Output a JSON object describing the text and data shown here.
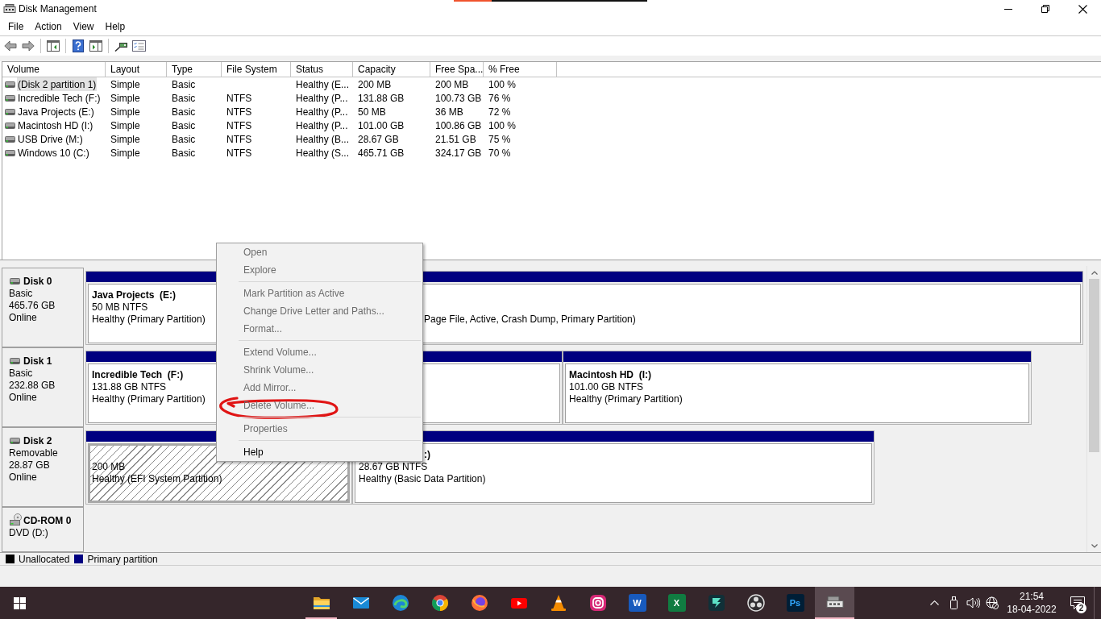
{
  "window": {
    "title": "Disk Management"
  },
  "menu": [
    "File",
    "Action",
    "View",
    "Help"
  ],
  "volume_list": {
    "columns": [
      "Volume",
      "Layout",
      "Type",
      "File System",
      "Status",
      "Capacity",
      "Free Spa...",
      "% Free"
    ],
    "rows": [
      {
        "volume": "(Disk 2 partition 1)",
        "layout": "Simple",
        "type": "Basic",
        "status": "Healthy (E...",
        "capacity": "200 MB",
        "free_space": "200 MB",
        "percent_free": "100 %",
        "selected": true
      },
      {
        "volume": "Incredible Tech (F:)",
        "layout": "Simple",
        "type": "Basic",
        "file_system": "NTFS",
        "status": "Healthy (P...",
        "capacity": "131.88 GB",
        "free_space": "100.73 GB",
        "percent_free": "76 %",
        "selected": false
      },
      {
        "volume": "Java Projects (E:)",
        "layout": "Simple",
        "type": "Basic",
        "file_system": "NTFS",
        "status": "Healthy (P...",
        "capacity": "50 MB",
        "free_space": "36 MB",
        "percent_free": "72 %",
        "selected": false
      },
      {
        "volume": "Macintosh HD (I:)",
        "layout": "Simple",
        "type": "Basic",
        "file_system": "NTFS",
        "status": "Healthy (P...",
        "capacity": "101.00 GB",
        "free_space": "100.86 GB",
        "percent_free": "100 %",
        "selected": false
      },
      {
        "volume": "USB Drive (M:)",
        "layout": "Simple",
        "type": "Basic",
        "file_system": "NTFS",
        "status": "Healthy (B...",
        "capacity": "28.67 GB",
        "free_space": "21.51 GB",
        "percent_free": "75 %",
        "selected": false
      },
      {
        "volume": "Windows 10 (C:)",
        "layout": "Simple",
        "type": "Basic",
        "file_system": "NTFS",
        "status": "Healthy (S...",
        "capacity": "465.71 GB",
        "free_space": "324.17 GB",
        "percent_free": "70 %",
        "selected": false
      }
    ]
  },
  "disks": [
    {
      "kind": "disk",
      "name": "Disk 0",
      "details": [
        "Basic",
        "465.76 GB",
        "Online"
      ],
      "partitions": [
        {
          "title": "Java Projects  (E:)",
          "size": "50 MB NTFS",
          "status": "Healthy (Primary Partition)",
          "selected": false
        },
        {
          "status": "Page File, Active, Crash Dump, Primary Partition)",
          "selected": false
        }
      ]
    },
    {
      "kind": "disk",
      "name": "Disk 1",
      "details": [
        "Basic",
        "232.88 GB",
        "Online"
      ],
      "partitions": [
        {
          "title": "Incredible Tech  (F:)",
          "size": "131.88 GB NTFS",
          "status": "Healthy (Primary Partition)",
          "selected": false
        },
        {
          "title": "Macintosh HD  (I:)",
          "size": "101.00 GB NTFS",
          "status": "Healthy (Primary Partition)",
          "selected": false
        }
      ]
    },
    {
      "kind": "disk",
      "name": "Disk 2",
      "details": [
        "Removable",
        "28.87 GB",
        "Online"
      ],
      "partitions": [
        {
          "size": "200 MB",
          "status": "Healthy (EFI System Partition)",
          "selected": true
        },
        {
          "title": ":)",
          "size": "28.67 GB NTFS",
          "status": "Healthy (Basic Data Partition)",
          "selected": false
        }
      ]
    },
    {
      "kind": "cdrom",
      "name": "CD-ROM 0",
      "details": [
        "DVD (D:)"
      ]
    }
  ],
  "legend": [
    {
      "label": "Unallocated",
      "color": "#000000"
    },
    {
      "label": "Primary partition",
      "color": "#000080"
    }
  ],
  "context_menu": [
    {
      "kind": "item",
      "label": "Open",
      "disabled": true
    },
    {
      "kind": "item",
      "label": "Explore",
      "disabled": true
    },
    {
      "kind": "separator"
    },
    {
      "kind": "item",
      "label": "Mark Partition as Active",
      "disabled": true
    },
    {
      "kind": "item",
      "label": "Change Drive Letter and Paths...",
      "disabled": true
    },
    {
      "kind": "item",
      "label": "Format...",
      "disabled": true
    },
    {
      "kind": "separator"
    },
    {
      "kind": "item",
      "label": "Extend Volume...",
      "disabled": true
    },
    {
      "kind": "item",
      "label": "Shrink Volume...",
      "disabled": true
    },
    {
      "kind": "item",
      "label": "Add Mirror...",
      "disabled": true
    },
    {
      "kind": "item",
      "label": "Delete Volume...",
      "disabled": true
    },
    {
      "kind": "separator"
    },
    {
      "kind": "item",
      "label": "Properties",
      "disabled": true
    },
    {
      "kind": "separator"
    },
    {
      "kind": "item",
      "label": "Help",
      "disabled": false
    }
  ],
  "taskbar": {
    "apps": [
      {
        "kind": "folder",
        "running": true,
        "selected": false
      },
      {
        "kind": "envelope",
        "running": false,
        "selected": false
      },
      {
        "kind": "swirl",
        "running": false,
        "selected": false
      },
      {
        "kind": "ring",
        "running": false,
        "selected": false
      },
      {
        "kind": "fox",
        "running": false,
        "selected": false
      },
      {
        "kind": "play",
        "running": false,
        "selected": false
      },
      {
        "kind": "cone",
        "running": false,
        "selected": false
      },
      {
        "kind": "camera",
        "running": false,
        "selected": false
      },
      {
        "kind": "doc",
        "label": "W",
        "running": false,
        "selected": false
      },
      {
        "kind": "sheet",
        "label": "X",
        "running": false,
        "selected": false
      },
      {
        "kind": "film",
        "running": false,
        "selected": false
      },
      {
        "kind": "aperture",
        "running": false,
        "selected": false
      },
      {
        "kind": "design",
        "label": "Ps",
        "running": false,
        "selected": false
      },
      {
        "kind": "drive",
        "running": true,
        "selected": true
      }
    ],
    "clock": {
      "time": "21:54",
      "date": "18-04-2022"
    },
    "notification_count": "2"
  }
}
